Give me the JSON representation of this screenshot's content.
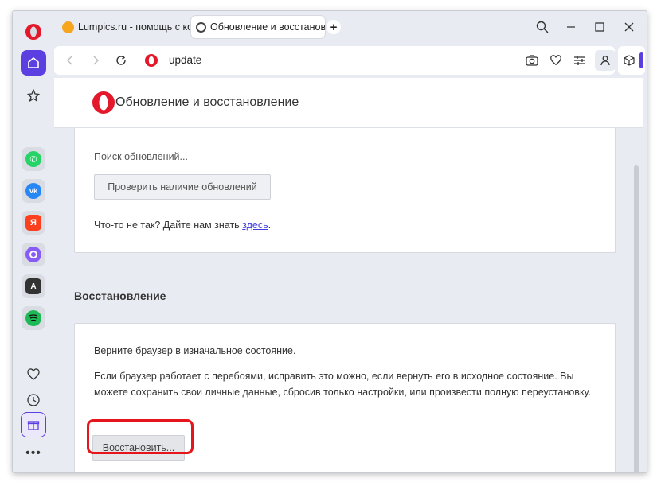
{
  "tabs": [
    {
      "label": "Lumpics.ru - помощь с ко",
      "favicon": "orange-favicon",
      "active": false
    },
    {
      "label": "Обновление и восстанов",
      "favicon": "opera-favicon",
      "active": true
    }
  ],
  "address_bar": {
    "url": "update"
  },
  "page": {
    "title": "Обновление и восстановление",
    "update_card": {
      "status": "Поиск обновлений...",
      "check_button": "Проверить наличие обновлений",
      "feedback_prefix": "Что-то не так? Дайте нам знать ",
      "feedback_link": "здесь",
      "feedback_suffix": "."
    },
    "recovery": {
      "section_title": "Восстановление",
      "intro": "Верните браузер в изначальное состояние.",
      "description": "Если браузер работает с перебоями, исправить это можно, если вернуть его в исходное состояние. Вы можете сохранить свои личные данные, сбросив только настройки, или произвести полную переустановку.",
      "restore_button": "Восстановить..."
    }
  },
  "sidebar": {
    "apps": [
      "whatsapp-icon",
      "vk-icon",
      "yandex-icon",
      "alice-icon",
      "translate-icon",
      "spotify-icon"
    ]
  },
  "colors": {
    "opera_red": "#e3182a",
    "accent": "#5b3fe0",
    "highlight": "#e5151b"
  }
}
